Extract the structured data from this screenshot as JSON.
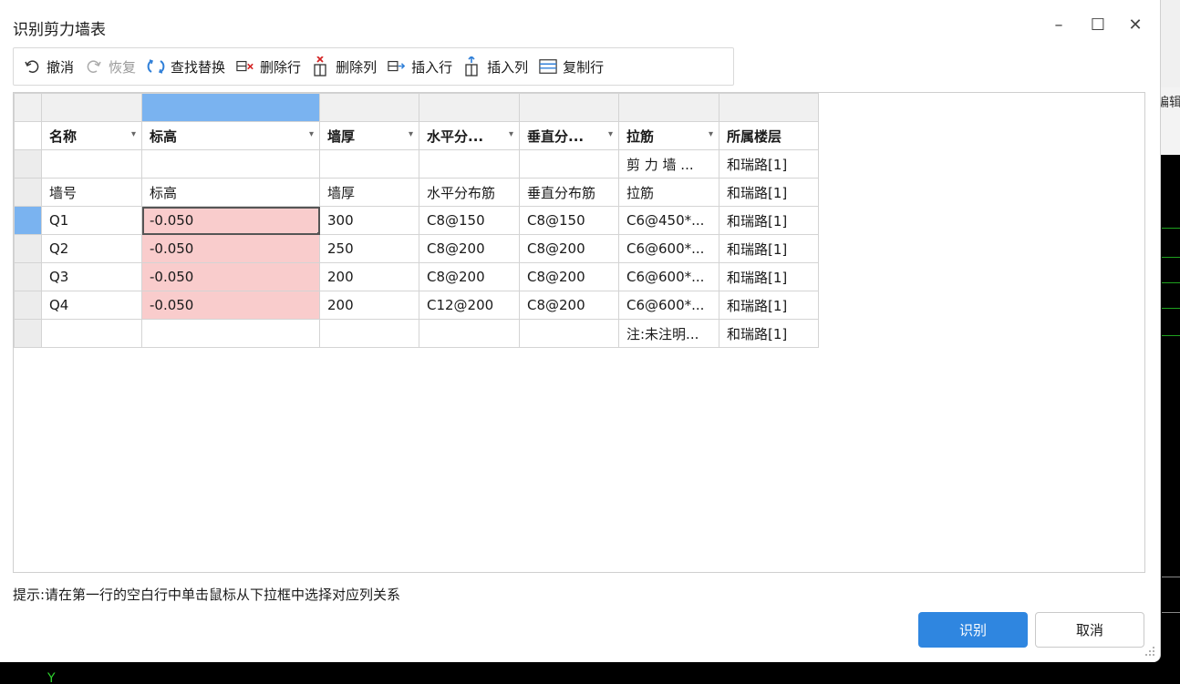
{
  "dialog": {
    "title": "识别剪力墙表",
    "hint": "提示:请在第一行的空白行中单击鼠标从下拉框中选择对应列关系",
    "ok_label": "识别",
    "cancel_label": "取消"
  },
  "window_controls": {
    "minimize": "–",
    "maximize": "☐",
    "close": "✕"
  },
  "toolbar": {
    "undo": "撤消",
    "redo": "恢复",
    "find_replace": "查找替换",
    "delete_row": "删除行",
    "delete_col": "删除列",
    "insert_row": "插入行",
    "insert_col": "插入列",
    "copy_row": "复制行"
  },
  "grid": {
    "column_headers": [
      "名称",
      "标高",
      "墙厚",
      "水平分...",
      "垂直分...",
      "拉筋",
      "所属楼层"
    ],
    "rows": [
      [
        "",
        "",
        "",
        "",
        "",
        "剪 力 墙 ...",
        "和瑞路[1]"
      ],
      [
        "墙号",
        "标高",
        "墙厚",
        "水平分布筋",
        "垂直分布筋",
        "拉筋",
        "和瑞路[1]"
      ],
      [
        "Q1",
        "-0.050",
        "300",
        "C8@150",
        "C8@150",
        "C6@450*...",
        "和瑞路[1]"
      ],
      [
        "Q2",
        "-0.050",
        "250",
        "C8@200",
        "C8@200",
        "C6@600*...",
        "和瑞路[1]"
      ],
      [
        "Q3",
        "-0.050",
        "200",
        "C8@200",
        "C8@200",
        "C6@600*...",
        "和瑞路[1]"
      ],
      [
        "Q4",
        "-0.050",
        "200",
        "C12@200",
        "C8@200",
        "C6@600*...",
        "和瑞路[1]"
      ],
      [
        "",
        "",
        "",
        "",
        "",
        "注:未注明...",
        "和瑞路[1]"
      ]
    ]
  },
  "background": {
    "side_text": "编辑",
    "axis_label": "Y"
  },
  "colors": {
    "primary_button": "#2f86e0",
    "selected_column": "#7ab3f0",
    "highlight_cell": "#f9cccc"
  }
}
